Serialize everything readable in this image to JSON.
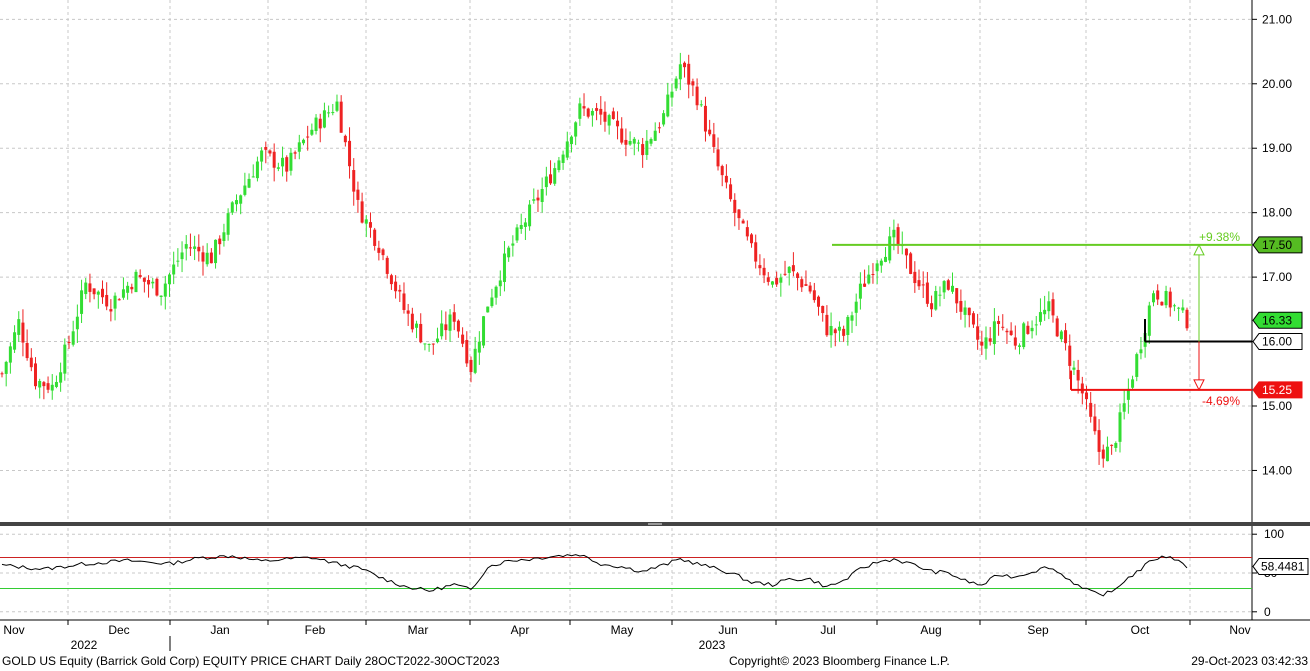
{
  "chart_data": {
    "type": "candlestick",
    "colors": {
      "up": "#33dd33",
      "down": "#ee2222",
      "upper_line": "#66cc22",
      "lower_line": "#ee1111",
      "osc_line": "#000000",
      "osc_upper": "#cc2222",
      "osc_lower": "#33cc33",
      "grid": "#c8c8c8"
    },
    "price_axis": {
      "ylim": [
        13.2,
        21.3
      ],
      "ticks": [
        "21.00",
        "20.00",
        "19.00",
        "18.00",
        "17.00",
        "16.00",
        "15.00",
        "14.00"
      ],
      "tick_values": [
        21,
        20,
        19,
        18,
        17,
        16,
        15,
        14
      ]
    },
    "osc_axis": {
      "ylim": [
        -8,
        108
      ],
      "ticks": [
        "100",
        "50",
        "0"
      ],
      "tick_values": [
        100,
        50,
        0
      ]
    },
    "months": [
      "Nov",
      "Dec",
      "Jan",
      "Feb",
      "Mar",
      "Apr",
      "May",
      "Jun",
      "Jul",
      "Aug",
      "Sep",
      "Oct",
      "Nov"
    ],
    "years": [
      "2022",
      "2023"
    ],
    "levels": [
      {
        "label": "17.50",
        "value": 17.5,
        "pct": "+9.38%",
        "color": "#66cc22"
      },
      {
        "label": "16.00",
        "value": 16.0,
        "color": "#000000"
      },
      {
        "label": "15.25",
        "value": 15.25,
        "pct": "-4.69%",
        "color": "#ee1111"
      }
    ],
    "last_price": "16.33",
    "last_value": 16.33,
    "osc_value_label": "58.4481",
    "osc_last": 58.4,
    "osc_upper": 70,
    "osc_lower": 30,
    "anchors": [
      [
        0,
        15.5
      ],
      [
        4,
        16.3
      ],
      [
        8,
        15.4
      ],
      [
        12,
        15.3
      ],
      [
        16,
        16.0
      ],
      [
        20,
        16.9
      ],
      [
        26,
        16.6
      ],
      [
        32,
        17.0
      ],
      [
        38,
        16.8
      ],
      [
        44,
        17.5
      ],
      [
        50,
        17.3
      ],
      [
        56,
        18.2
      ],
      [
        62,
        18.9
      ],
      [
        68,
        18.7
      ],
      [
        74,
        19.3
      ],
      [
        80,
        19.7
      ],
      [
        85,
        18.1
      ],
      [
        90,
        17.5
      ],
      [
        96,
        16.5
      ],
      [
        102,
        15.9
      ],
      [
        108,
        16.4
      ],
      [
        112,
        15.6
      ],
      [
        116,
        16.6
      ],
      [
        121,
        17.4
      ],
      [
        126,
        18.0
      ],
      [
        132,
        18.7
      ],
      [
        138,
        19.6
      ],
      [
        143,
        19.5
      ],
      [
        148,
        19.2
      ],
      [
        153,
        19.0
      ],
      [
        158,
        19.5
      ],
      [
        162,
        20.3
      ],
      [
        166,
        19.8
      ],
      [
        171,
        18.7
      ],
      [
        175,
        18.0
      ],
      [
        179,
        17.4
      ],
      [
        184,
        16.9
      ],
      [
        188,
        17.1
      ],
      [
        193,
        16.8
      ],
      [
        197,
        16.2
      ],
      [
        201,
        16.1
      ],
      [
        205,
        16.8
      ],
      [
        209,
        17.3
      ],
      [
        213,
        17.6
      ],
      [
        218,
        17.0
      ],
      [
        222,
        16.6
      ],
      [
        226,
        16.9
      ],
      [
        230,
        16.4
      ],
      [
        234,
        15.9
      ],
      [
        238,
        16.3
      ],
      [
        242,
        16.0
      ],
      [
        246,
        16.3
      ],
      [
        250,
        16.5
      ],
      [
        254,
        15.9
      ],
      [
        258,
        15.2
      ],
      [
        262,
        14.3
      ],
      [
        265,
        14.3
      ],
      [
        268,
        15.0
      ],
      [
        272,
        16.0
      ],
      [
        275,
        16.8
      ],
      [
        279,
        16.6
      ],
      [
        283,
        16.33
      ]
    ],
    "osc_anchors": [
      [
        0,
        60
      ],
      [
        10,
        55
      ],
      [
        20,
        62
      ],
      [
        30,
        66
      ],
      [
        40,
        62
      ],
      [
        48,
        70
      ],
      [
        55,
        72
      ],
      [
        62,
        65
      ],
      [
        68,
        68
      ],
      [
        74,
        70
      ],
      [
        80,
        62
      ],
      [
        86,
        55
      ],
      [
        90,
        45
      ],
      [
        96,
        33
      ],
      [
        102,
        27
      ],
      [
        108,
        35
      ],
      [
        112,
        28
      ],
      [
        116,
        58
      ],
      [
        121,
        66
      ],
      [
        126,
        68
      ],
      [
        132,
        72
      ],
      [
        138,
        74
      ],
      [
        143,
        62
      ],
      [
        148,
        58
      ],
      [
        153,
        52
      ],
      [
        158,
        60
      ],
      [
        162,
        68
      ],
      [
        166,
        62
      ],
      [
        171,
        55
      ],
      [
        175,
        48
      ],
      [
        179,
        38
      ],
      [
        184,
        35
      ],
      [
        188,
        42
      ],
      [
        193,
        42
      ],
      [
        197,
        32
      ],
      [
        201,
        40
      ],
      [
        205,
        55
      ],
      [
        209,
        64
      ],
      [
        213,
        68
      ],
      [
        218,
        60
      ],
      [
        222,
        52
      ],
      [
        226,
        50
      ],
      [
        230,
        40
      ],
      [
        234,
        34
      ],
      [
        238,
        48
      ],
      [
        242,
        45
      ],
      [
        246,
        52
      ],
      [
        250,
        58
      ],
      [
        254,
        45
      ],
      [
        258,
        30
      ],
      [
        262,
        22
      ],
      [
        265,
        25
      ],
      [
        268,
        40
      ],
      [
        272,
        55
      ],
      [
        275,
        68
      ],
      [
        279,
        72
      ],
      [
        283,
        58.4
      ]
    ]
  },
  "footer": {
    "left": "GOLD US Equity (Barrick Gold Corp) EQUITY PRICE CHART  Daily 28OCT2022-30OCT2023",
    "center": "Copyright© 2023 Bloomberg Finance L.P.",
    "right": "29-Oct-2023 03:42:33"
  }
}
